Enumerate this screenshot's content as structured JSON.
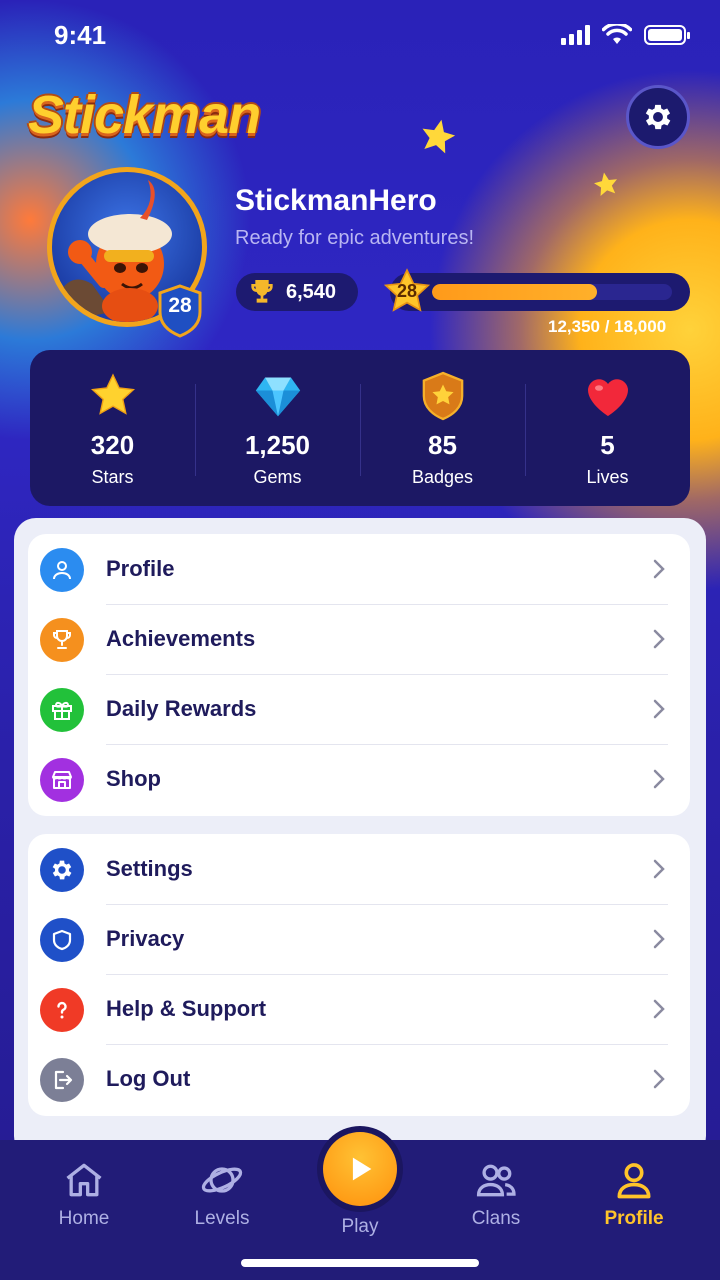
{
  "status": {
    "time": "9:41"
  },
  "app": {
    "logo": "Stickman"
  },
  "player": {
    "name": "StickmanHero",
    "tagline": "Ready for epic adventures!",
    "level": "28",
    "trophies": "6,540",
    "xp_text": "12,350 / 18,000",
    "xp_progress": 0.686
  },
  "stats": [
    {
      "icon": "star-icon",
      "value": "320",
      "label": "Stars"
    },
    {
      "icon": "diamond-icon",
      "value": "1,250",
      "label": "Gems"
    },
    {
      "icon": "badge-icon",
      "value": "85",
      "label": "Badges"
    },
    {
      "icon": "heart-icon",
      "value": "5",
      "label": "Lives"
    }
  ],
  "menu_primary": [
    {
      "label": "Profile",
      "icon": "user-icon",
      "color": "#2b8cf0"
    },
    {
      "label": "Achievements",
      "icon": "trophy-icon",
      "color": "#f5901e"
    },
    {
      "label": "Daily Rewards",
      "icon": "gift-icon",
      "color": "#22c13a"
    },
    {
      "label": "Shop",
      "icon": "store-icon",
      "color": "#a230e0"
    }
  ],
  "menu_secondary": [
    {
      "label": "Settings",
      "icon": "gear-icon",
      "color": "#1f50c8"
    },
    {
      "label": "Privacy",
      "icon": "shield-icon",
      "color": "#1f50c8"
    },
    {
      "label": "Help & Support",
      "icon": "question-icon",
      "color": "#f03a26"
    },
    {
      "label": "Log Out",
      "icon": "logout-icon",
      "color": "#7c7f96"
    }
  ],
  "nav": {
    "home": "Home",
    "levels": "Levels",
    "play": "Play",
    "clans": "Clans",
    "profile": "Profile",
    "active": "profile"
  },
  "colors": {
    "accent": "#ffc42a",
    "background": "#2a22b8",
    "text_dark": "#1f1b5c"
  }
}
